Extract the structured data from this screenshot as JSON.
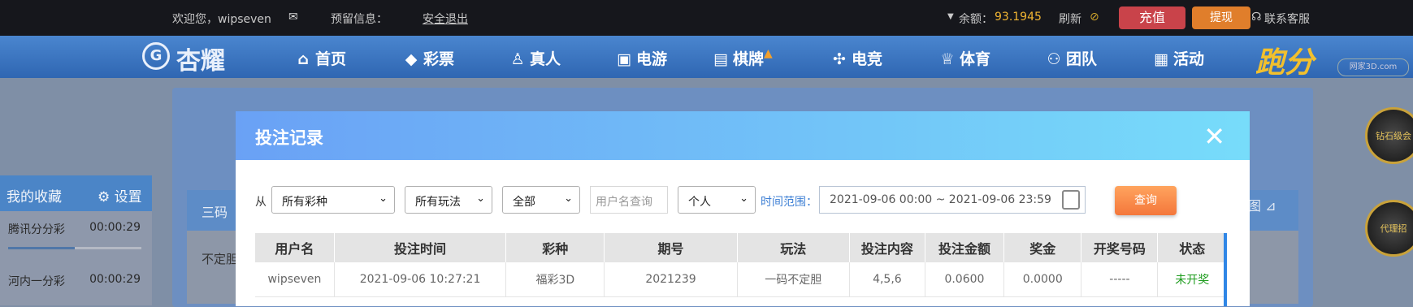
{
  "topbar": {
    "welcome": "欢迎您，wipseven",
    "reserve_info": "预留信息：",
    "logout": "安全退出",
    "balance_label": "余额：",
    "balance_value": "93.1945",
    "refresh": "刷新",
    "recharge": "充值",
    "withdraw": "提现",
    "support": "联系客服",
    "colors": {
      "recharge": "#c9434a",
      "withdraw": "#e07e2b",
      "balance": "#f2b632"
    }
  },
  "nav": {
    "logo_text": "杏耀",
    "items": [
      {
        "label": "首页",
        "icon": "home-icon"
      },
      {
        "label": "彩票",
        "icon": "ticket-icon"
      },
      {
        "label": "真人",
        "icon": "person-icon"
      },
      {
        "label": "电游",
        "icon": "slot-icon"
      },
      {
        "label": "棋牌",
        "icon": "cards-icon"
      },
      {
        "label": "电竞",
        "icon": "gamepad-icon"
      },
      {
        "label": "体育",
        "icon": "trophy-icon"
      },
      {
        "label": "团队",
        "icon": "team-icon"
      },
      {
        "label": "活动",
        "icon": "gift-icon"
      }
    ],
    "score_logo": "跑分",
    "watermark": "网家3D.com"
  },
  "sidebar": {
    "title": "我的收藏",
    "settings": "设置",
    "items": [
      {
        "name": "腾讯分分彩",
        "time": "00:00:29",
        "progress": 0.5
      },
      {
        "name": "河内一分彩",
        "time": "00:00:29"
      }
    ]
  },
  "background": {
    "tab_label": "三码",
    "row_text": "不定胆"
  },
  "badges": [
    "钻石级会",
    "代理招"
  ],
  "modal": {
    "title": "投注记录",
    "close": "✕",
    "filters": {
      "from_label": "从",
      "lottery": "所有彩种",
      "play": "所有玩法",
      "status": "全部",
      "username_placeholder": "用户名查询",
      "scope": "个人",
      "time_label": "时间范围：",
      "date_range": "2021-09-06 00:00 ~ 2021-09-06 23:59",
      "query": "查询"
    },
    "table": {
      "headers": [
        "用户名",
        "投注时间",
        "彩种",
        "期号",
        "玩法",
        "投注内容",
        "投注金额",
        "奖金",
        "开奖号码",
        "状态"
      ],
      "rows": [
        [
          "wipseven",
          "2021-09-06 10:27:21",
          "福彩3D",
          "2021239",
          "一码不定胆",
          "4,5,6",
          "0.0600",
          "0.0000",
          "-----",
          "未开奖"
        ]
      ]
    }
  }
}
